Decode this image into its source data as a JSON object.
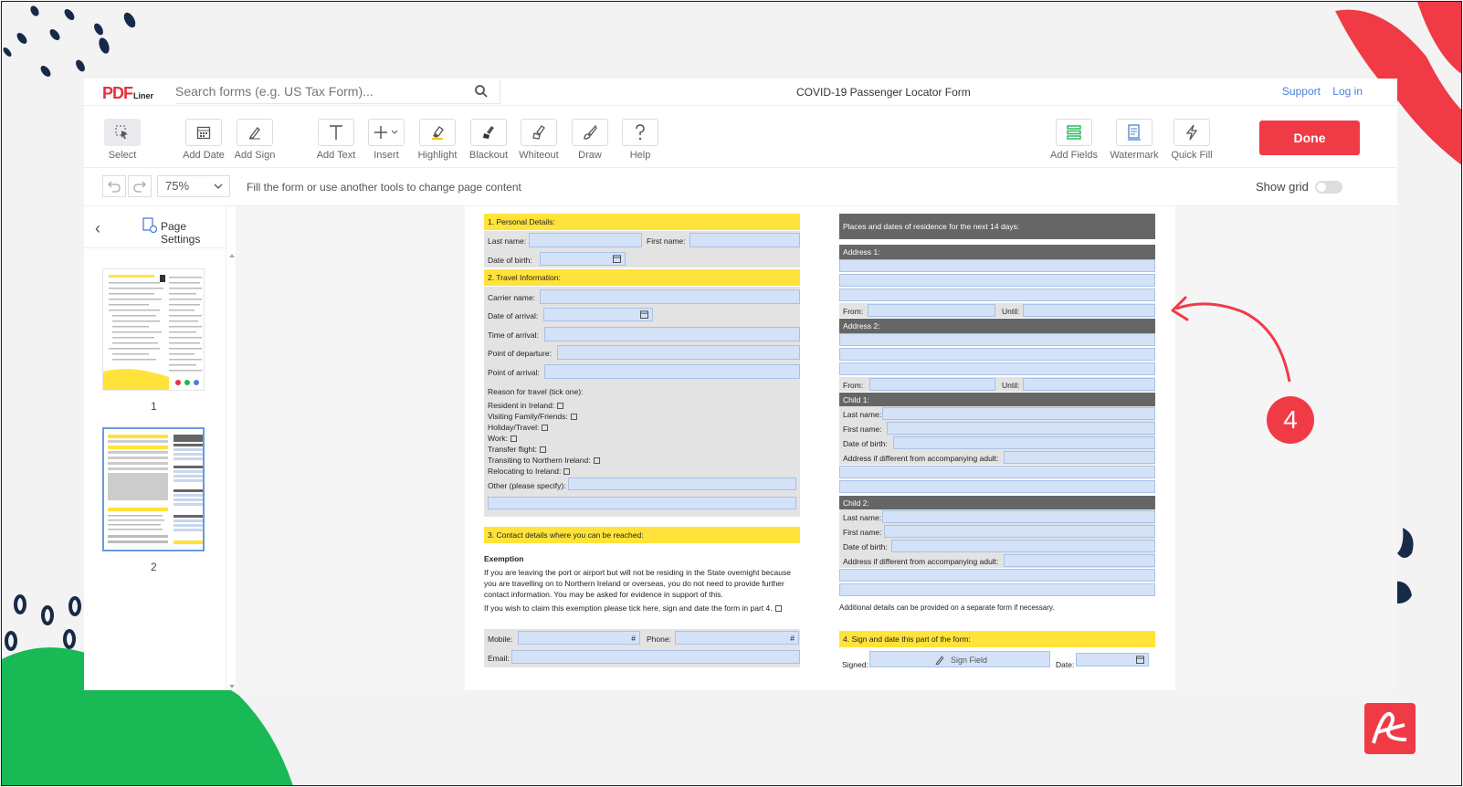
{
  "app": {
    "logo": "PDF",
    "logo_suffix": "Liner",
    "search_placeholder": "Search forms (e.g. US Tax Form)...",
    "doc_title": "COVID-19 Passenger Locator Form",
    "links": {
      "support": "Support",
      "login": "Log in"
    }
  },
  "toolbar": {
    "tools": [
      {
        "label": "Select",
        "icon": "select-cursor-icon"
      },
      {
        "label": "Add Date",
        "icon": "calendar-icon"
      },
      {
        "label": "Add Sign",
        "icon": "pen-icon"
      },
      {
        "label": "Add Text",
        "icon": "text-t-icon"
      },
      {
        "label": "Insert",
        "icon": "plus-icon"
      },
      {
        "label": "Highlight",
        "icon": "highlighter-icon"
      },
      {
        "label": "Blackout",
        "icon": "blackout-brush-icon"
      },
      {
        "label": "Whiteout",
        "icon": "eraser-icon"
      },
      {
        "label": "Draw",
        "icon": "brush-icon"
      },
      {
        "label": "Help",
        "icon": "question-icon"
      },
      {
        "label": "Add Fields",
        "icon": "fields-icon"
      },
      {
        "label": "Watermark",
        "icon": "watermark-icon"
      },
      {
        "label": "Quick Fill",
        "icon": "lightning-icon"
      }
    ],
    "done_label": "Done"
  },
  "subbar": {
    "zoom": "75%",
    "hint": "Fill the form or use another tools to change page content",
    "show_grid": "Show grid",
    "show_grid_on": false
  },
  "sidebar": {
    "page_settings": "Page Settings",
    "pages": [
      "1",
      "2"
    ],
    "selected_page": 2
  },
  "form": {
    "s1": "1. Personal Details:",
    "last_name": "Last name:",
    "first_name": "First name:",
    "dob": "Date of birth:",
    "s2": "2. Travel Information:",
    "carrier": "Carrier name:",
    "date_arrival": "Date of arrival:",
    "time_arrival": "Time of arrival:",
    "point_departure": "Point of departure:",
    "point_arrival": "Point of arrival:",
    "reason": "Reason for travel (tick one):",
    "reasons": [
      "Resident in Ireland:",
      "Visiting Family/Friends:",
      "Holiday/Travel:",
      "Work:",
      "Transfer flight:",
      "Transiting to Northern Ireland:",
      "Relocating to Ireland:"
    ],
    "other": "Other (please specify):",
    "s3": "3. Contact details where you can be reached:",
    "exemption": "Exemption",
    "exemption_lines": [
      "If you are leaving the port or airport but will not be residing in the State overnight because",
      "you are travelling on to Northern Ireland or overseas, you do not need to provide further",
      "contact information. You may be asked for evidence in support of this."
    ],
    "exemption_claim": "If you wish to claim this exemption please tick here, sign and date the form in part 4.",
    "mobile": "Mobile:",
    "phone": "Phone:",
    "email": "Email:",
    "hash": "#",
    "places": "Places and dates of residence for the next 14 days:",
    "address1": "Address 1:",
    "address2": "Address 2:",
    "from": "From:",
    "until": "Until:",
    "child1": "Child 1:",
    "child2": "Child 2:",
    "address_diff": "Address if different from accompanying adult:",
    "additional": "Additional details can be provided on a separate form if necessary.",
    "s4": "4. Sign and date this part of the form:",
    "signed": "Signed:",
    "sign_field": "Sign Field",
    "date": "Date:"
  },
  "annotation": {
    "number": "4",
    "color": "#f03b47"
  }
}
